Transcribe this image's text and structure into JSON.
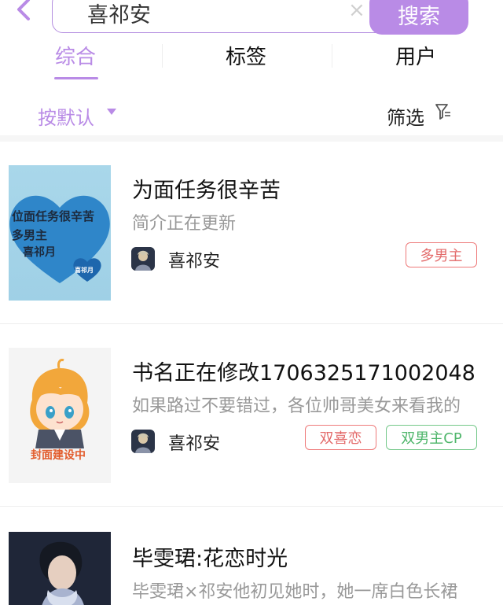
{
  "search": {
    "query": "喜祁安",
    "clear_glyph": "×",
    "button_label": "搜索"
  },
  "tabs": [
    {
      "label": "综合",
      "active": true
    },
    {
      "label": "标签",
      "active": false
    },
    {
      "label": "用户",
      "active": false
    }
  ],
  "sort": {
    "label": "按默认",
    "filter_label": "筛选"
  },
  "colors": {
    "accent": "#b98be6",
    "tag_red": "#e36a6a",
    "tag_green": "#4eb56a"
  },
  "books": [
    {
      "title": "为面任务很辛苦",
      "description": "简介正在更新",
      "author": "喜祁安",
      "tags": [
        {
          "label": "多男主",
          "color": "red"
        }
      ],
      "cover": {
        "lines": [
          "位面任务很辛苦",
          "多男主",
          "喜祁月"
        ],
        "badge": "喜祁月"
      }
    },
    {
      "title": "书名正在修改1706325171002048",
      "description": "如果路过不要错过，各位帅哥美女来看我的",
      "author": "喜祁安",
      "tags": [
        {
          "label": "双喜恋",
          "color": "red"
        },
        {
          "label": "双男主CP",
          "color": "green"
        }
      ],
      "cover": {
        "caption": "封面建设中"
      }
    },
    {
      "title": "毕雯珺:花恋时光",
      "description": "毕雯珺×祁安他初见她时，她一席白色长裙"
    }
  ]
}
